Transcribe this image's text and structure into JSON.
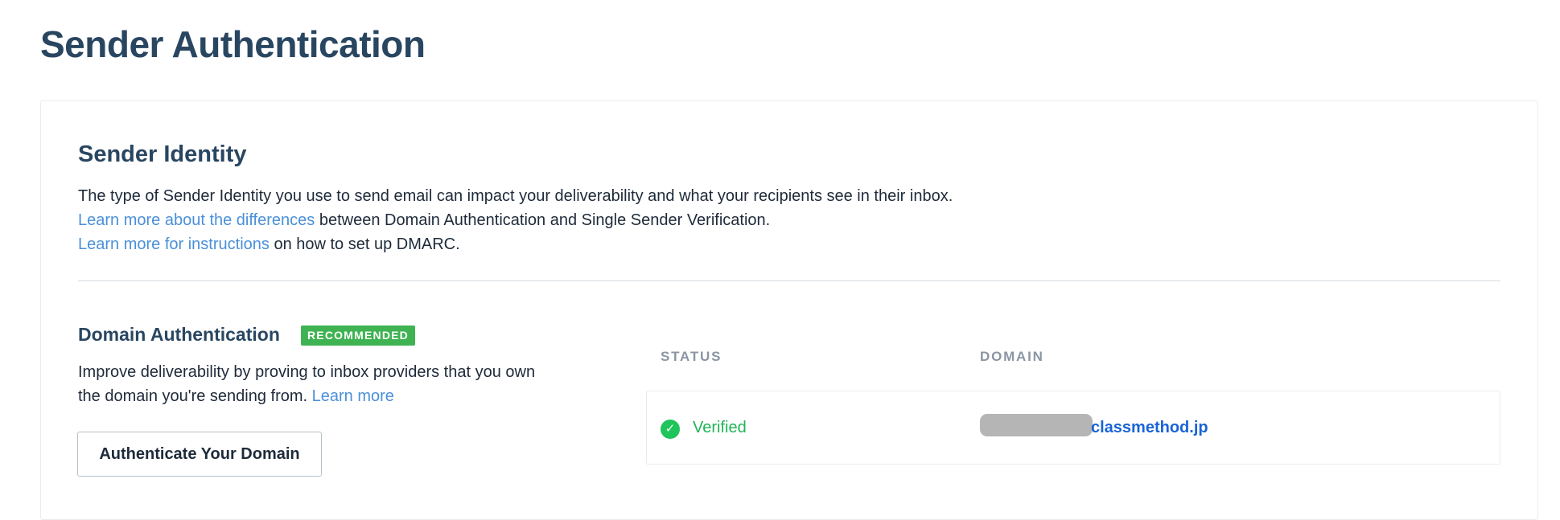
{
  "page": {
    "title": "Sender Authentication"
  },
  "sender_identity": {
    "title": "Sender Identity",
    "line1": "The type of Sender Identity you use to send email can impact your deliverability and what your recipients see in their inbox.",
    "line2_link": "Learn more about the differences",
    "line2_text": " between Domain Authentication and Single Sender Verification.",
    "line3_link": "Learn more for instructions",
    "line3_text": " on how to set up DMARC."
  },
  "domain_authentication": {
    "title": "Domain Authentication",
    "badge": "RECOMMENDED",
    "description": "Improve deliverability by proving to inbox providers that you own the domain you're sending from.",
    "learn_more": "Learn more",
    "button_label": "Authenticate Your Domain",
    "table": {
      "headers": {
        "status": "STATUS",
        "domain": "DOMAIN"
      },
      "rows": [
        {
          "status": "Verified",
          "status_icon": "check-circle-icon",
          "domain": "classmethod.jp"
        }
      ]
    }
  },
  "colors": {
    "heading": "#294661",
    "link": "#4a90d9",
    "badge": "#3fb352",
    "verified": "#1fb457",
    "domain_link": "#1a64d6"
  }
}
